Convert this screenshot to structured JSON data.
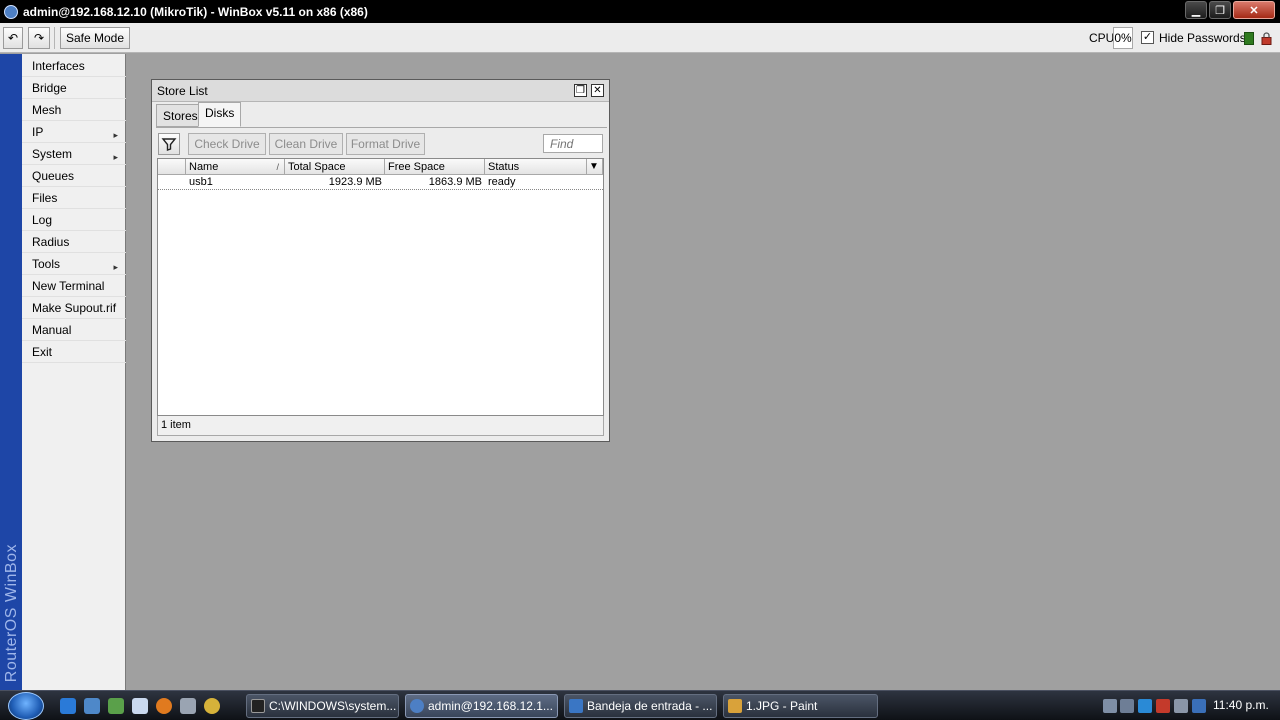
{
  "window": {
    "title": "admin@192.168.12.10 (MikroTik) - WinBox v5.11 on x86 (x86)",
    "min_glyph": "▁",
    "max_glyph": "❐",
    "close_glyph": "✕"
  },
  "toolbar": {
    "undo_glyph": "↶",
    "redo_glyph": "↷",
    "safe_mode": "Safe Mode",
    "cpu_label": "CPU:",
    "cpu_value": "0%",
    "hide_passwords_checked": true,
    "hide_passwords_check_glyph": "✓",
    "hide_passwords": "Hide Passwords"
  },
  "side_brand": "RouterOS WinBox",
  "menu": {
    "items": [
      {
        "label": "Interfaces",
        "arrow": ""
      },
      {
        "label": "Bridge",
        "arrow": ""
      },
      {
        "label": "Mesh",
        "arrow": ""
      },
      {
        "label": "IP",
        "arrow": "▸"
      },
      {
        "label": "System",
        "arrow": "▸"
      },
      {
        "label": "Queues",
        "arrow": ""
      },
      {
        "label": "Files",
        "arrow": ""
      },
      {
        "label": "Log",
        "arrow": ""
      },
      {
        "label": "Radius",
        "arrow": ""
      },
      {
        "label": "Tools",
        "arrow": "▸"
      },
      {
        "label": "New Terminal",
        "arrow": ""
      },
      {
        "label": "Make Supout.rif",
        "arrow": ""
      },
      {
        "label": "Manual",
        "arrow": ""
      },
      {
        "label": "Exit",
        "arrow": ""
      }
    ]
  },
  "store_list": {
    "title": "Store List",
    "restore_glyph": "❐",
    "close_glyph": "✕",
    "tabs": [
      "Stores",
      "Disks"
    ],
    "active_tab": "Disks",
    "buttons": {
      "check_drive": "Check Drive",
      "clean_drive": "Clean Drive",
      "format_drive": "Format Drive"
    },
    "find_placeholder": "Find",
    "columns": {
      "name": "Name",
      "sort_glyph": "/",
      "total_space": "Total Space",
      "free_space": "Free Space",
      "status": "Status",
      "menu_glyph": "▼"
    },
    "rows": [
      {
        "name": "usb1",
        "total_space": "1923.9 MB",
        "free_space": "1863.9 MB",
        "status": "ready"
      }
    ],
    "status_bar": "1 item"
  },
  "taskbar": {
    "tasks": [
      {
        "label": "C:\\WINDOWS\\system...",
        "icon": "cmd-icon",
        "active": false
      },
      {
        "label": "admin@192.168.12.1...",
        "icon": "winbox-icon",
        "active": true
      },
      {
        "label": "Bandeja de entrada - ...",
        "icon": "mail-icon",
        "active": false
      },
      {
        "label": "1.JPG - Paint",
        "icon": "paint-icon",
        "active": false
      }
    ],
    "clock": "11:40 p.m."
  },
  "colors": {
    "side_strip": "#1e46a7",
    "desktop": "#a0a0a0",
    "title_bar": "#000000"
  }
}
